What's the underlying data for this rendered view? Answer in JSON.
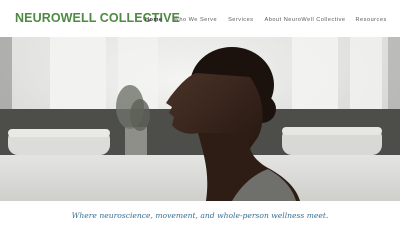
{
  "header": {
    "logo": "NEUROWELL COLLECTIVE",
    "nav": [
      {
        "label": "Home",
        "active": true
      },
      {
        "label": "Who We Serve",
        "active": false
      },
      {
        "label": "Services",
        "active": false
      },
      {
        "label": "About NeuroWell Collective",
        "active": false
      },
      {
        "label": "Resources",
        "active": false
      }
    ]
  },
  "hero": {
    "image": "woman-profile-silhouette-yoga-studio"
  },
  "tagline": "Where neuroscience, movement, and whole-person wellness meet.",
  "colors": {
    "brand_green": "#4e8a42",
    "tagline_blue": "#3a6f93",
    "nav_text": "#5b5b5b"
  }
}
